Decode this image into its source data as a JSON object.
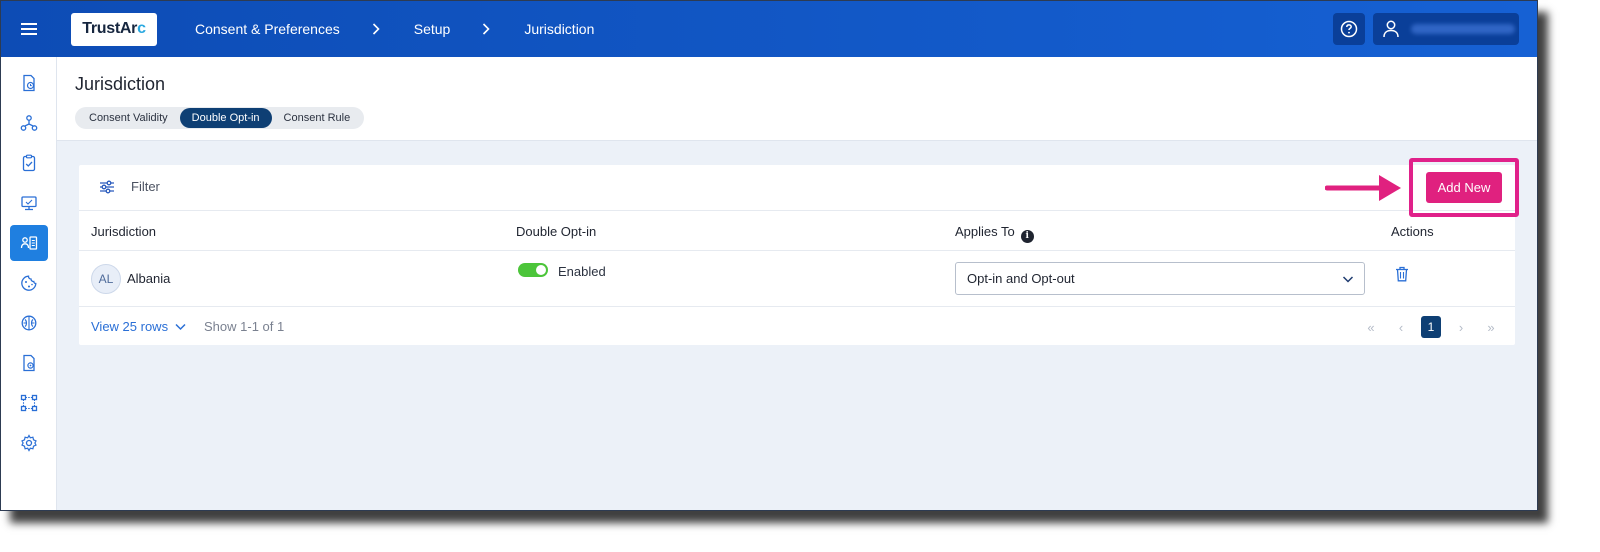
{
  "topbar": {
    "logo_main": "TrustAr",
    "logo_accent": "c",
    "breadcrumbs": [
      "Consent & Preferences",
      "Setup",
      "Jurisdiction"
    ],
    "help_icon": "question-circle-icon",
    "user_icon": "user-icon"
  },
  "sidebar": {
    "items": [
      {
        "icon": "document-clock-icon"
      },
      {
        "icon": "network-icon"
      },
      {
        "icon": "clipboard-check-icon"
      },
      {
        "icon": "monitor-icon"
      },
      {
        "icon": "user-list-icon",
        "active": true
      },
      {
        "icon": "cookie-icon"
      },
      {
        "icon": "brain-icon"
      },
      {
        "icon": "document-settings-icon"
      },
      {
        "icon": "workflow-icon"
      },
      {
        "icon": "gear-icon"
      }
    ]
  },
  "page": {
    "title": "Jurisdiction",
    "tabs": [
      "Consent Validity",
      "Double Opt-in",
      "Consent Rule"
    ],
    "active_tab": "Double Opt-in"
  },
  "toolbar": {
    "filter_label": "Filter",
    "add_new_label": "Add New"
  },
  "table": {
    "headers": [
      "Jurisdiction",
      "Double Opt-in",
      "Applies To",
      "Actions"
    ],
    "rows": [
      {
        "initials": "AL",
        "jurisdiction": "Albania",
        "double_opt_in": "Enabled",
        "double_opt_in_enabled": true,
        "applies_to": "Opt-in and Opt-out"
      }
    ]
  },
  "footer": {
    "view_rows": "View 25 rows",
    "show_count": "Show 1-1 of 1",
    "current_page": "1",
    "first_glyph": "«",
    "prev_glyph": "‹",
    "next_glyph": "›",
    "last_glyph": "»"
  },
  "colors": {
    "topbar": "#1155c8",
    "accent_pink": "#e0217f",
    "active_tab": "#0e3f74",
    "toggle_on": "#4cc53a"
  }
}
